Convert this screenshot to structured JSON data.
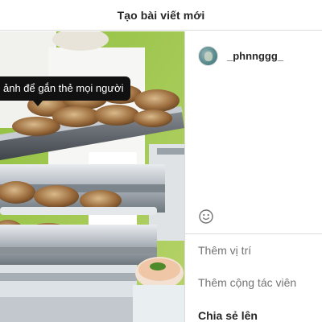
{
  "header": {
    "title": "Tạo bài viết mới"
  },
  "photo": {
    "tooltip": "ảnh để gắn thẻ mọi người",
    "alt": "Đĩa thịt nướng trên khay buffet"
  },
  "panel": {
    "username": "_phnnggg_",
    "options": {
      "location": "Thêm vị trí",
      "collaborators": "Thêm cộng tác viên",
      "share": "Chia sẻ lên"
    }
  },
  "colors": {
    "text": "#262626",
    "muted": "#737373",
    "border": "#dbdbdb",
    "tooltip_bg": "#111111"
  }
}
